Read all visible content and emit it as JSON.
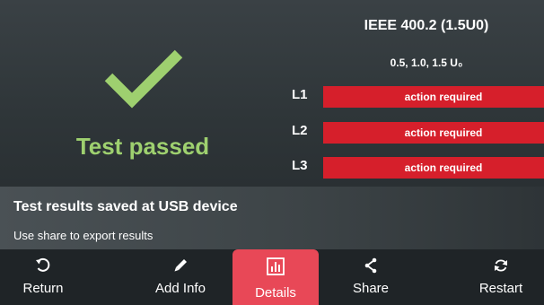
{
  "result": {
    "status_text": "Test passed",
    "status_icon": "checkmark-icon",
    "status_color": "#9ed06f"
  },
  "standard": {
    "title": "IEEE 400.2 (1.5U0)",
    "voltage_levels": "0.5, 1.0, 1.5 U₀"
  },
  "lines": [
    {
      "label": "L1",
      "status": "action required"
    },
    {
      "label": "L2",
      "status": "action required"
    },
    {
      "label": "L3",
      "status": "action required"
    }
  ],
  "message": {
    "title": "Test results saved at USB device",
    "subtitle": "Use share to export results"
  },
  "toolbar": {
    "return_label": "Return",
    "add_info_label": "Add Info",
    "details_label": "Details",
    "share_label": "Share",
    "restart_label": "Restart"
  },
  "colors": {
    "alert_red": "#d61f2b",
    "accent_pink": "#e84857",
    "pass_green": "#9ed06f"
  }
}
